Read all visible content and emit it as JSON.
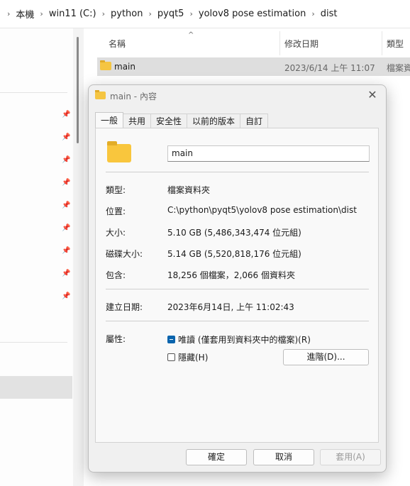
{
  "address_bar": {
    "crumbs": [
      "本機",
      "win11 (C:)",
      "python",
      "pyqt5",
      "yolov8 pose estimation",
      "dist"
    ]
  },
  "file_list": {
    "columns": {
      "name": "名稱",
      "modified": "修改日期",
      "type": "類型"
    },
    "rows": [
      {
        "name": "main",
        "modified": "2023/6/14 上午 11:07",
        "type": "檔案資料夾"
      }
    ]
  },
  "dialog": {
    "title": "main - 內容",
    "tabs": [
      "一般",
      "共用",
      "安全性",
      "以前的版本",
      "自訂"
    ],
    "name_value": "main",
    "props": {
      "type_label": "類型:",
      "type_value": "檔案資料夾",
      "location_label": "位置:",
      "location_value": "C:\\python\\pyqt5\\yolov8 pose estimation\\dist",
      "size_label": "大小:",
      "size_value": "5.10 GB (5,486,343,474 位元組)",
      "disk_size_label": "磁碟大小:",
      "disk_size_value": "5.14 GB (5,520,818,176 位元組)",
      "contains_label": "包含:",
      "contains_value": "18,256 個檔案，2,066 個資料夾",
      "created_label": "建立日期:",
      "created_value": "2023年6月14日, 上午 11:02:43",
      "attributes_label": "屬性:"
    },
    "attributes": {
      "readonly_label": "唯讀 (僅套用到資料夾中的檔案)(R)",
      "hidden_label": "隱藏(H)",
      "advanced_button": "進階(D)..."
    },
    "buttons": {
      "ok": "確定",
      "cancel": "取消",
      "apply": "套用(A)"
    }
  }
}
